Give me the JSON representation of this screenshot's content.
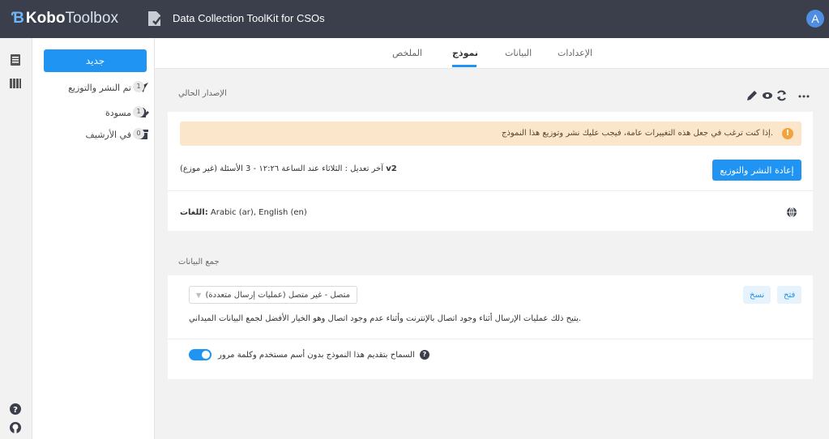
{
  "app": {
    "logo_k": "Ɓ",
    "logo_bold": "Kobo",
    "logo_light": "Toolbox",
    "project_title": "Data Collection ToolKit for CSOs",
    "avatar_letter": "A"
  },
  "sidebar": {
    "new_button": "جديد",
    "items": [
      {
        "label": "تم النشر والتوزيع",
        "count": "1",
        "icon": "rocket-icon"
      },
      {
        "label": "مسودة",
        "count": "1",
        "icon": "draft-pencil-icon"
      },
      {
        "label": "في الأرشيف",
        "count": "0",
        "icon": "archive-icon"
      }
    ]
  },
  "tabs": [
    {
      "label": "الإعدادات",
      "active": false
    },
    {
      "label": "البيانات",
      "active": false
    },
    {
      "label": "نموذج",
      "active": true
    },
    {
      "label": "الملخص",
      "active": false
    }
  ],
  "form": {
    "current_version_label": "الإصدار الحالي",
    "warning": ".إذا كنت ترغب في جعل هذه التغييرات عامة، فيجب عليك نشر وتوزيع هذا النموذج",
    "warning_icon": "!",
    "redeploy_button": "إعادة النشر والتوزيع",
    "version": "v2",
    "meta_text": "آخر تعديل : الثلاثاء عند الساعة ١٢:٢٦ - 3 الأسئلة  (غير موزع)",
    "languages_label": "اللغات:",
    "languages_value": " Arabic (ar), English (en)"
  },
  "collect": {
    "section_label": "جمع البيانات",
    "select_value": "متصل - غير متصل (عمليات إرسال متعددة)",
    "open_button": "فتح",
    "copy_button": "نسخ",
    "description": ".يتيح ذلك عمليات الإرسال أثناء وجود اتصال بالإنترنت وأثناء عدم وجود اتصال وهو الخيار الأفضل لجمع البيانات الميداني",
    "toggle_label": "السماح بتقديم هذا النموذج بدون أسم مستخدم وكلمة مرور",
    "toggle_on": true
  },
  "colors": {
    "topbar": "#3a3f4b",
    "accent": "#2094f3",
    "warning_bg": "#fbe6cc",
    "warning_icon": "#f0a53c"
  }
}
